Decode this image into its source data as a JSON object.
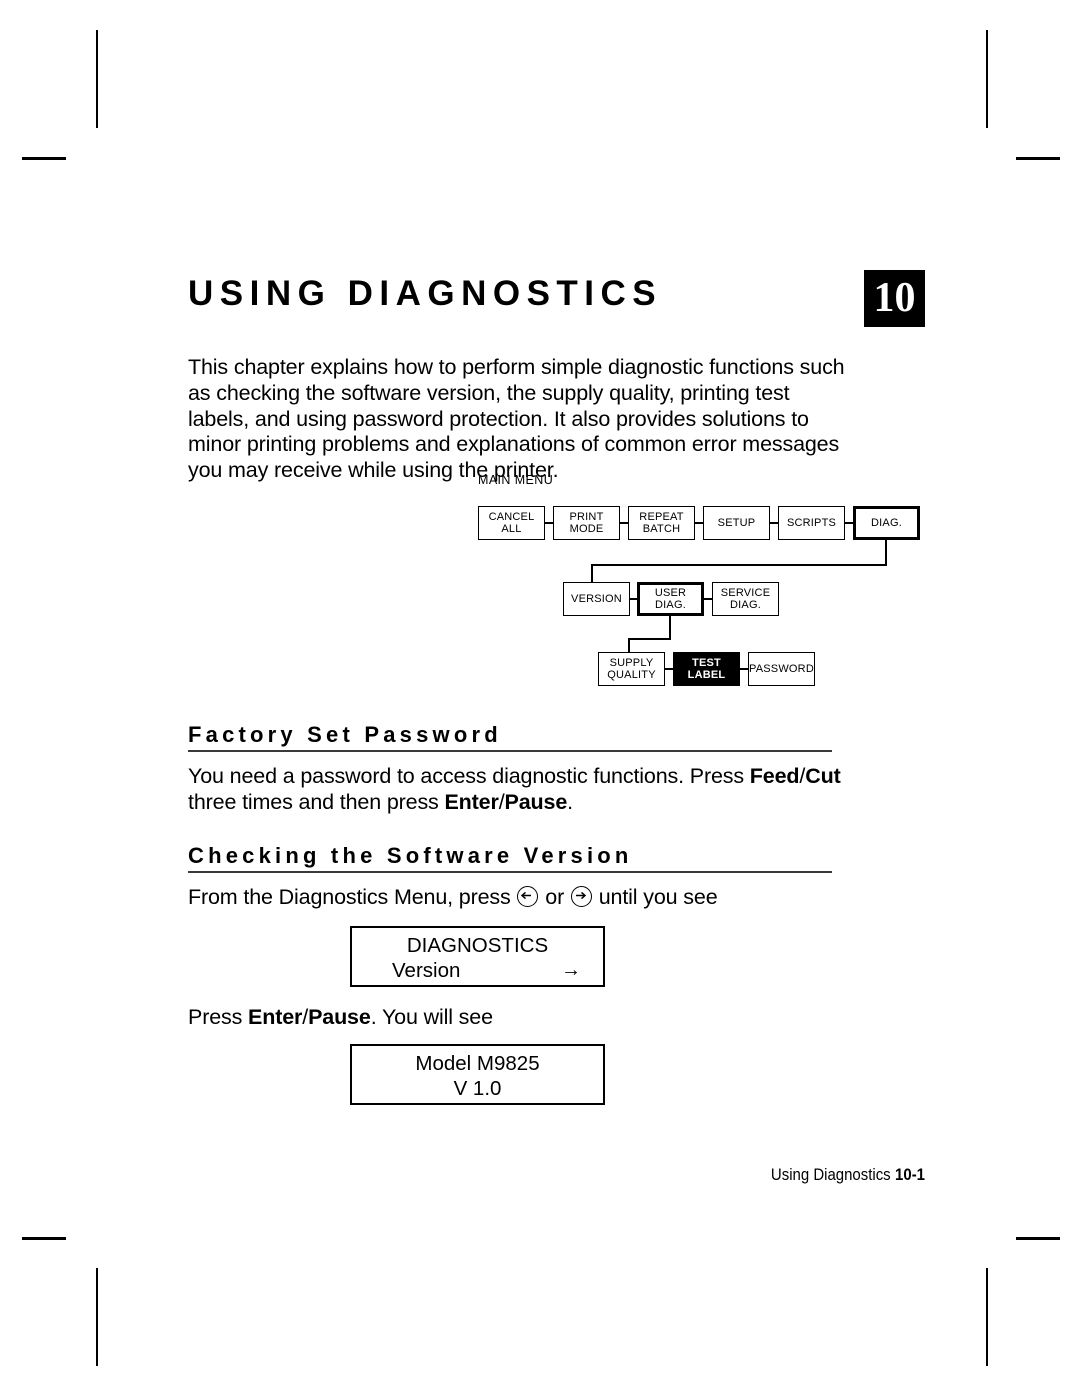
{
  "chapter": {
    "title": "USING DIAGNOSTICS",
    "number_badge": "10",
    "intro_paragraph": "This chapter explains how to perform simple diagnostic functions such as checking the software version, the supply quality, printing test labels, and using password protection.  It also provides solutions to minor printing problems and explanations of common error messages you may receive while using the printer."
  },
  "menu_map": {
    "title": "MAIN MENU",
    "rows": [
      {
        "name": "main-menu-row",
        "boxes": [
          {
            "label": "CANCEL\nALL",
            "state": "normal"
          },
          {
            "label": "PRINT\nMODE",
            "state": "normal"
          },
          {
            "label": "REPEAT\nBATCH",
            "state": "normal"
          },
          {
            "label": "SETUP",
            "state": "normal"
          },
          {
            "label": "SCRIPTS",
            "state": "normal"
          },
          {
            "label": "DIAG.",
            "state": "selected"
          }
        ]
      },
      {
        "name": "diagnostics-submenu-row",
        "boxes": [
          {
            "label": "VERSION",
            "state": "normal"
          },
          {
            "label": "USER DIAG.",
            "state": "selected"
          },
          {
            "label": "SERVICE\nDIAG.",
            "state": "normal"
          }
        ]
      },
      {
        "name": "user-diagnostics-submenu-row",
        "boxes": [
          {
            "label": "SUPPLY\nQUALITY",
            "state": "normal"
          },
          {
            "label": "TEST\nLABEL",
            "state": "inverted"
          },
          {
            "label": "PASSWORD",
            "state": "normal"
          }
        ]
      }
    ]
  },
  "sections": [
    {
      "heading": "Factory Set Password",
      "body_prefix": "You need a password to access diagnostic functions.  Press ",
      "body_bold_1": "Feed",
      "body_mid_1": "/",
      "body_bold_2": "Cut",
      "body_mid_2": " three times and then press ",
      "body_bold_3": "Enter",
      "body_mid_3": "/",
      "body_bold_4": "Pause",
      "body_suffix": "."
    },
    {
      "heading": "Checking the Software Version",
      "intro_prefix": "From the Diagnostics Menu, press ",
      "intro_mid": " or ",
      "intro_suffix": " until you see",
      "press_prefix": "Press ",
      "press_bold_1": "Enter",
      "press_mid_1": "/",
      "press_bold_2": "Pause",
      "press_suffix": ".  You will see"
    }
  ],
  "lcd_displays": [
    {
      "name": "diagnostics-version-display",
      "line1": "DIAGNOSTICS",
      "line2": "Version",
      "arrow": "→"
    },
    {
      "name": "model-version-display",
      "line1": "Model M9825",
      "line2": "V 1.0"
    }
  ],
  "footer": {
    "chapter_name": "Using Diagnostics",
    "page_number": "10-1"
  },
  "colors": {
    "ink": "#000000",
    "paper": "#ffffff",
    "rule": "#3a3a3a"
  }
}
